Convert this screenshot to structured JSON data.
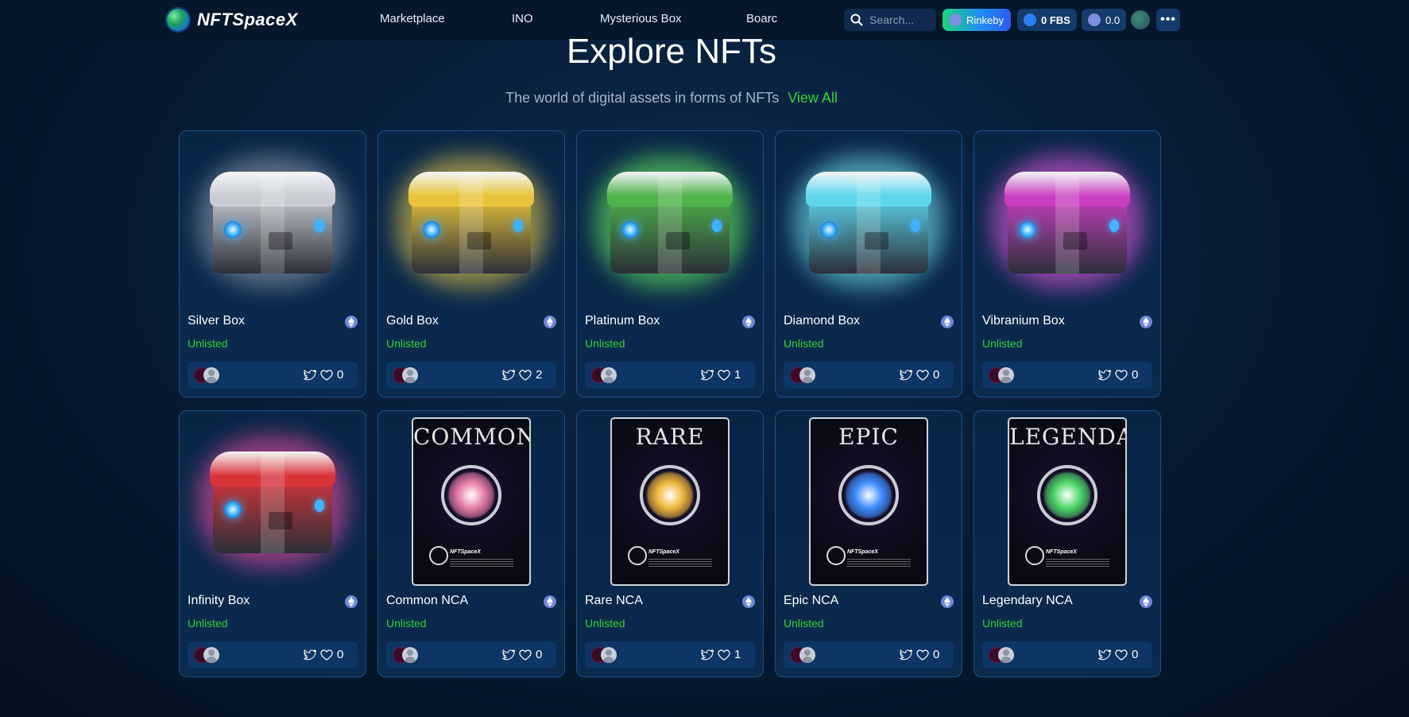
{
  "nav": {
    "logo_text": "NFTSpaceX",
    "links": [
      "Marketplace",
      "INO",
      "Mysterious Box",
      "Boarc"
    ],
    "search_placeholder": "Search...",
    "network_label": "Rinkeby",
    "fbs_balance": "0 FBS",
    "balance": "0.0",
    "more_label": "•••"
  },
  "header": {
    "title": "Explore NFTs",
    "subtitle": "The world of digital assets in forms of NFTs",
    "view_all": "View All"
  },
  "colors": {
    "accent_green": "#34d135",
    "card_border": "#1e4f86",
    "bar_bg": "#0d3566"
  },
  "cards": [
    {
      "name": "Silver Box",
      "status": "Unlisted",
      "likes": "0",
      "art": "chest",
      "color": "#c9ccd2",
      "glow": "#9aa3b3"
    },
    {
      "name": "Gold Box",
      "status": "Unlisted",
      "likes": "2",
      "art": "chest",
      "color": "#e9c43a",
      "glow": "#ffd94a"
    },
    {
      "name": "Platinum Box",
      "status": "Unlisted",
      "likes": "1",
      "art": "chest",
      "color": "#4fb34a",
      "glow": "#6dff5c"
    },
    {
      "name": "Diamond Box",
      "status": "Unlisted",
      "likes": "0",
      "art": "chest",
      "color": "#5cd6ec",
      "glow": "#7ff3ff"
    },
    {
      "name": "Vibranium Box",
      "status": "Unlisted",
      "likes": "0",
      "art": "chest",
      "color": "#c93fc0",
      "glow": "#ff5cf0"
    },
    {
      "name": "Infinity Box",
      "status": "Unlisted",
      "likes": "0",
      "art": "chest",
      "color": "#d8343a",
      "glow": "#ff4fb0"
    },
    {
      "name": "Common NCA",
      "status": "Unlisted",
      "likes": "0",
      "art": "nca",
      "label": "COMMON",
      "orb": "#e87fa8"
    },
    {
      "name": "Rare NCA",
      "status": "Unlisted",
      "likes": "1",
      "art": "nca",
      "label": "RARE",
      "orb": "#f0b83a"
    },
    {
      "name": "Epic NCA",
      "status": "Unlisted",
      "likes": "0",
      "art": "nca",
      "label": "EPIC",
      "orb": "#3f8dff"
    },
    {
      "name": "Legendary NCA",
      "status": "Unlisted",
      "likes": "0",
      "art": "nca",
      "label": "LEGENDARY",
      "orb": "#4fd86a"
    }
  ],
  "icons": {
    "search": "search-icon",
    "ethereum": "ethereum-icon",
    "share": "twitter-icon",
    "like": "heart-icon",
    "more": "more-horizontal-icon"
  }
}
